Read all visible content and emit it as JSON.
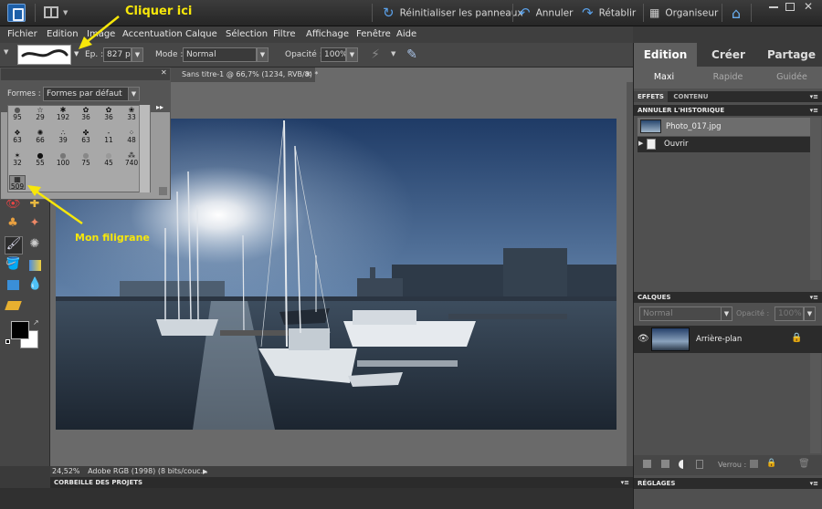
{
  "topbar": {
    "reset_panels": "Réinitialiser les panneaux",
    "undo": "Annuler",
    "redo": "Rétablir",
    "organizer": "Organiseur"
  },
  "menu": [
    "Fichier",
    "Edition",
    "Image",
    "Accentuation",
    "Calque",
    "Sélection",
    "Filtre",
    "Affichage",
    "Fenêtre",
    "Aide"
  ],
  "options": {
    "size_label": "Ep. :",
    "size_value": "827 px",
    "mode_label": "Mode :",
    "mode_value": "Normal",
    "opacity_label": "Opacité :",
    "opacity_value": "100%"
  },
  "document": {
    "tab_title": "Sans titre-1 @ 66,7% (1234, RVB/8) *"
  },
  "brush_picker": {
    "shapes_label": "Formes :",
    "shapes_value": "Formes par défaut",
    "sizes": [
      "95",
      "29",
      "192",
      "36",
      "36",
      "33",
      "63",
      "66",
      "39",
      "63",
      "11",
      "48",
      "32",
      "55",
      "100",
      "75",
      "45",
      "740",
      "509"
    ]
  },
  "right_panel": {
    "tabs": [
      "Edition",
      "Créer",
      "Partage"
    ],
    "subtabs": [
      "Maxi",
      "Rapide",
      "Guidée"
    ],
    "effects_tab": "EFFETS",
    "content_tab": "CONTENU",
    "history_header": "ANNULER L'HISTORIQUE",
    "history_items": [
      "Photo_017.jpg",
      "Ouvrir"
    ],
    "layers_header": "CALQUES",
    "layer_mode": "Normal",
    "layer_opacity_label": "Opacité :",
    "layer_opacity_value": "100%",
    "layer_name": "Arrière-plan",
    "lock_label": "Verrou :",
    "adjustments_header": "RÉGLAGES"
  },
  "status": {
    "zoom": "24,52%",
    "profile": "Adobe RGB (1998) (8 bits/couc..."
  },
  "project_bin": "CORBEILLE DES PROJETS",
  "annotations": {
    "click_here": "Cliquer ici",
    "watermark": "Mon filigrane"
  }
}
